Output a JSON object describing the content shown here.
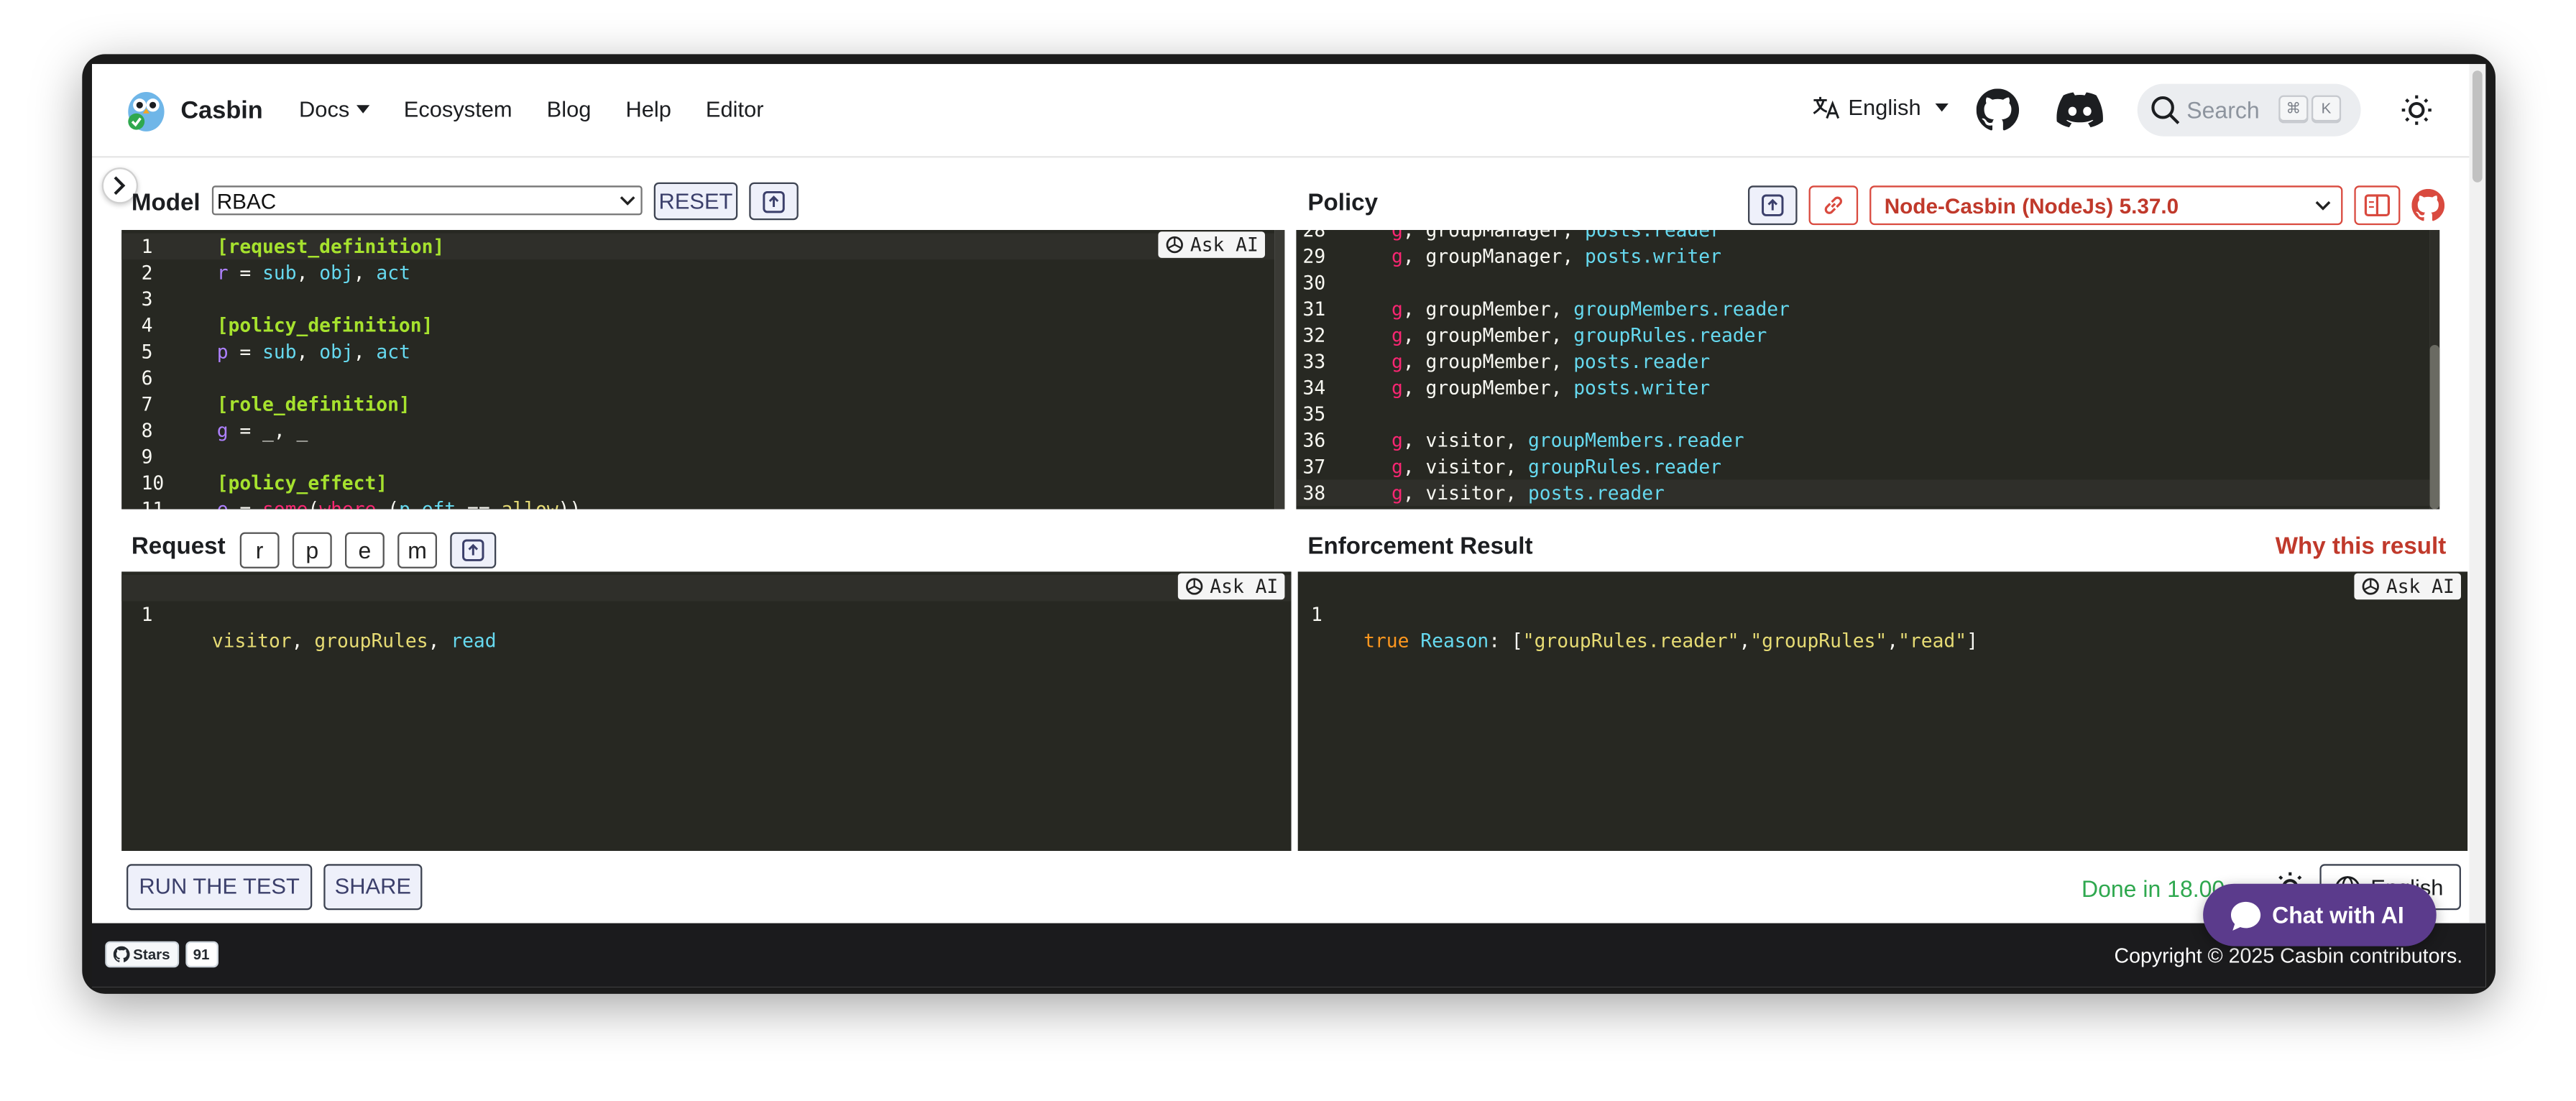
{
  "navbar": {
    "brand": "Casbin",
    "links": [
      "Docs",
      "Ecosystem",
      "Blog",
      "Help",
      "Editor"
    ],
    "language": "English",
    "search_placeholder": "Search",
    "search_keys": [
      "⌘",
      "K"
    ]
  },
  "model": {
    "title": "Model",
    "selected": "RBAC",
    "reset_label": "RESET",
    "ask_ai": "Ask AI",
    "lines": [
      {
        "n": "1",
        "parts": [
          [
            "kw-y",
            "[request_definition]"
          ]
        ]
      },
      {
        "n": "2",
        "parts": [
          [
            "c-p",
            "r"
          ],
          [
            "c-w",
            " = "
          ],
          [
            "c-b",
            "sub"
          ],
          [
            "c-w",
            ", "
          ],
          [
            "c-b",
            "obj"
          ],
          [
            "c-w",
            ", "
          ],
          [
            "c-b",
            "act"
          ]
        ]
      },
      {
        "n": "3",
        "parts": []
      },
      {
        "n": "4",
        "parts": [
          [
            "kw-y",
            "[policy_definition]"
          ]
        ]
      },
      {
        "n": "5",
        "parts": [
          [
            "c-p",
            "p"
          ],
          [
            "c-w",
            " = "
          ],
          [
            "c-b",
            "sub"
          ],
          [
            "c-w",
            ", "
          ],
          [
            "c-b",
            "obj"
          ],
          [
            "c-w",
            ", "
          ],
          [
            "c-b",
            "act"
          ]
        ]
      },
      {
        "n": "6",
        "parts": []
      },
      {
        "n": "7",
        "parts": [
          [
            "kw-y",
            "[role_definition]"
          ]
        ]
      },
      {
        "n": "8",
        "parts": [
          [
            "c-p",
            "g"
          ],
          [
            "c-w",
            " = _, _"
          ]
        ]
      },
      {
        "n": "9",
        "parts": []
      },
      {
        "n": "10",
        "parts": [
          [
            "kw-y",
            "[policy_effect]"
          ]
        ]
      },
      {
        "n": "11",
        "parts": [
          [
            "c-p",
            "e"
          ],
          [
            "c-w",
            " = "
          ],
          [
            "c-r",
            "some"
          ],
          [
            "c-w",
            "("
          ],
          [
            "c-r",
            "where"
          ],
          [
            "c-w",
            " ("
          ],
          [
            "c-b",
            "p.eft"
          ],
          [
            "c-w",
            " == "
          ],
          [
            "c-y",
            "allow"
          ],
          [
            "c-w",
            "))"
          ]
        ]
      }
    ]
  },
  "policy": {
    "title": "Policy",
    "engine": "Node-Casbin (NodeJs) 5.37.0",
    "lines": [
      {
        "n": "28",
        "parts": [
          [
            "c-r",
            "g"
          ],
          [
            "c-w",
            ", groupManager, "
          ],
          [
            "c-b",
            "posts.reader"
          ]
        ]
      },
      {
        "n": "29",
        "parts": [
          [
            "c-r",
            "g"
          ],
          [
            "c-w",
            ", groupManager, "
          ],
          [
            "c-b",
            "posts.writer"
          ]
        ]
      },
      {
        "n": "30",
        "parts": []
      },
      {
        "n": "31",
        "parts": [
          [
            "c-r",
            "g"
          ],
          [
            "c-w",
            ", groupMember, "
          ],
          [
            "c-b",
            "groupMembers.reader"
          ]
        ]
      },
      {
        "n": "32",
        "parts": [
          [
            "c-r",
            "g"
          ],
          [
            "c-w",
            ", groupMember, "
          ],
          [
            "c-b",
            "groupRules.reader"
          ]
        ]
      },
      {
        "n": "33",
        "parts": [
          [
            "c-r",
            "g"
          ],
          [
            "c-w",
            ", groupMember, "
          ],
          [
            "c-b",
            "posts.reader"
          ]
        ]
      },
      {
        "n": "34",
        "parts": [
          [
            "c-r",
            "g"
          ],
          [
            "c-w",
            ", groupMember, "
          ],
          [
            "c-b",
            "posts.writer"
          ]
        ]
      },
      {
        "n": "35",
        "parts": []
      },
      {
        "n": "36",
        "parts": [
          [
            "c-r",
            "g"
          ],
          [
            "c-w",
            ", visitor, "
          ],
          [
            "c-b",
            "groupMembers.reader"
          ]
        ]
      },
      {
        "n": "37",
        "parts": [
          [
            "c-r",
            "g"
          ],
          [
            "c-w",
            ", visitor, "
          ],
          [
            "c-b",
            "groupRules.reader"
          ]
        ]
      },
      {
        "n": "38",
        "parts": [
          [
            "c-r",
            "g"
          ],
          [
            "c-w",
            ", visitor, "
          ],
          [
            "c-b",
            "posts.reader"
          ]
        ]
      }
    ]
  },
  "request": {
    "title": "Request",
    "tokens": [
      "r",
      "p",
      "e",
      "m"
    ],
    "ask_ai": "Ask AI",
    "line_number": "1",
    "parts": [
      [
        "c-y",
        "visitor"
      ],
      [
        "c-w",
        ", "
      ],
      [
        "c-y",
        "groupRules"
      ],
      [
        "c-w",
        ", "
      ],
      [
        "c-b",
        "read"
      ]
    ]
  },
  "result": {
    "title": "Enforcement Result",
    "why_label": "Why this result",
    "ask_ai": "Ask AI",
    "line_number": "1",
    "parts": [
      [
        "c-o",
        "true"
      ],
      [
        "c-w",
        " "
      ],
      [
        "c-b",
        "Reason"
      ],
      [
        "c-w",
        ": ["
      ],
      [
        "c-y",
        "\"groupRules.reader\""
      ],
      [
        "c-w",
        ","
      ],
      [
        "c-y",
        "\"groupRules\""
      ],
      [
        "c-w",
        ","
      ],
      [
        "c-y",
        "\"read\""
      ],
      [
        "c-w",
        "]"
      ]
    ]
  },
  "actions": {
    "run_label": "RUN THE TEST",
    "share_label": "SHARE",
    "status": "Done in 18.00ms",
    "language": "English"
  },
  "footer": {
    "stars_label": "Stars",
    "stars_count": "91",
    "copyright": "Copyright © 2025 Casbin contributors."
  },
  "chat": {
    "label": "Chat with AI"
  },
  "colors": {
    "accent_red": "#c0392b",
    "status_green": "#2fa84f",
    "chat_purple": "#5b3b8c",
    "editor_bg": "#272822"
  }
}
